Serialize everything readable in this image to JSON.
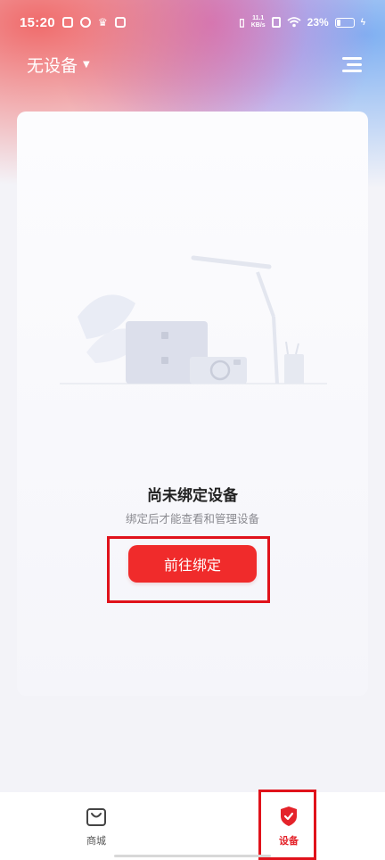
{
  "status_bar": {
    "time": "15:20",
    "net_speed_value": "11.1",
    "net_speed_unit": "KB/s",
    "battery_percent": "23%",
    "battery_level": 0.23
  },
  "header": {
    "device_selector_label": "无设备",
    "menu_icon": "hamburger-menu-icon"
  },
  "empty_state": {
    "title": "尚未绑定设备",
    "subtitle": "绑定后才能查看和管理设备",
    "bind_button_label": "前往绑定"
  },
  "tabs": [
    {
      "label": "商城",
      "icon": "shopping-bag-icon",
      "active": false
    },
    {
      "label": "设备",
      "icon": "shield-check-icon",
      "active": true
    }
  ],
  "colors": {
    "accent": "#f02b2b",
    "highlight_box": "#e0121b",
    "active_tab": "#e4232a"
  }
}
